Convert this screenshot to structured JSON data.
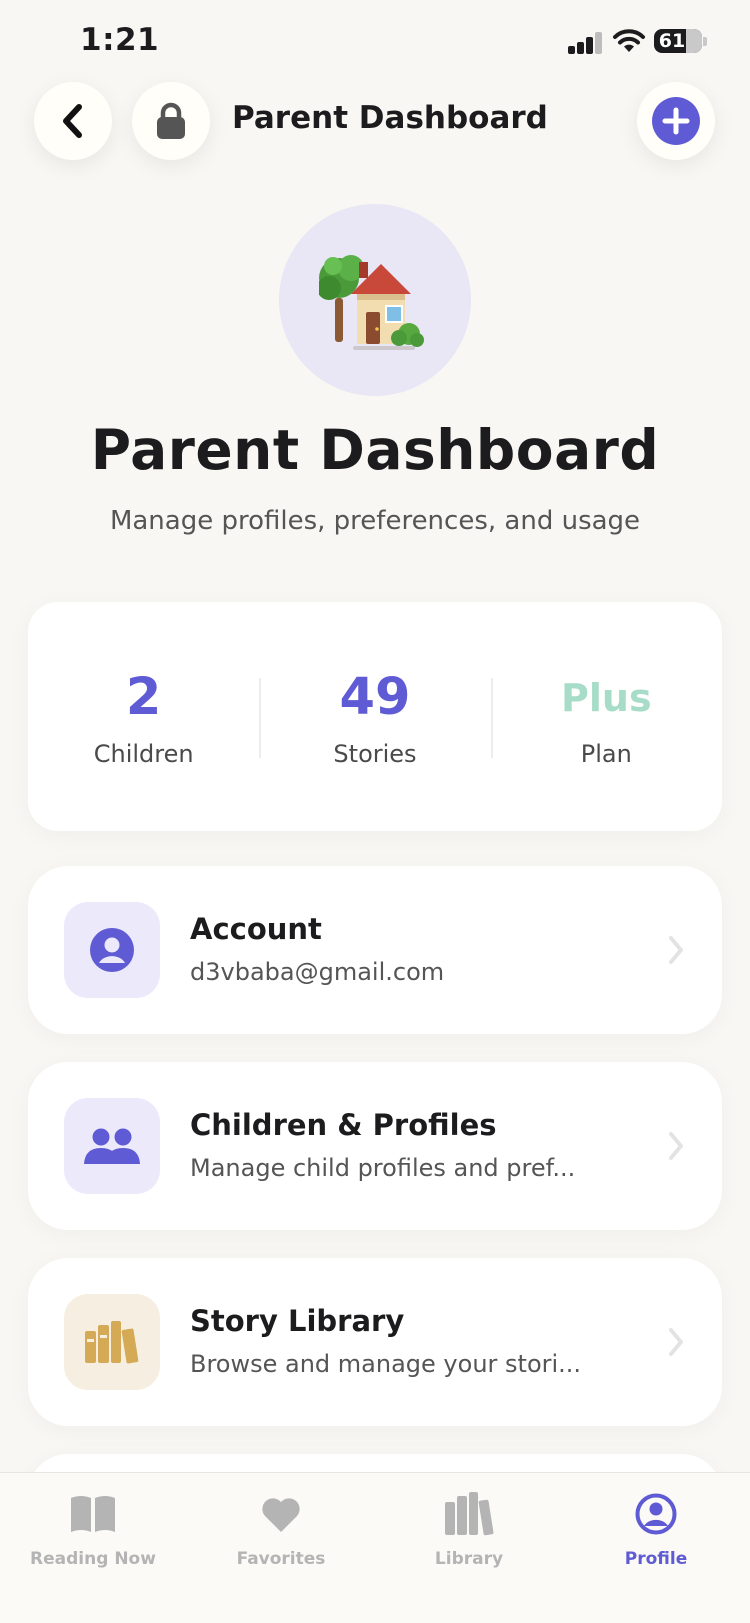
{
  "status_bar": {
    "time": "1:21",
    "battery": "61"
  },
  "nav": {
    "title": "Parent Dashboard"
  },
  "hero": {
    "emoji": "🏡",
    "title": "Parent Dashboard",
    "subtitle": "Manage profiles, preferences, and usage"
  },
  "stats": [
    {
      "value": "2",
      "label": "Children",
      "color": "#5f5bd4"
    },
    {
      "value": "49",
      "label": "Stories",
      "color": "#5f5bd4"
    },
    {
      "value": "Plus",
      "label": "Plan",
      "color": "#a7dcc8"
    }
  ],
  "menu": [
    {
      "title": "Account",
      "subtitle": "d3vbaba@gmail.com",
      "icon": "person-icon",
      "icon_bg": "#ece9fb"
    },
    {
      "title": "Children & Profiles",
      "subtitle": "Manage child profiles and pref...",
      "icon": "people-icon",
      "icon_bg": "#ece9fb"
    },
    {
      "title": "Story Library",
      "subtitle": "Browse and manage your stori...",
      "icon": "books-icon",
      "icon_bg": "#f6efe1"
    }
  ],
  "tabs": [
    {
      "label": "Reading Now",
      "icon": "book-icon",
      "active": false
    },
    {
      "label": "Favorites",
      "icon": "heart-icon",
      "active": false
    },
    {
      "label": "Library",
      "icon": "books-icon",
      "active": false
    },
    {
      "label": "Profile",
      "icon": "profile-icon",
      "active": true
    }
  ],
  "colors": {
    "accent": "#5f5bd4",
    "background": "#f8f7f3",
    "plan": "#a7dcc8",
    "library_icon": "#d4aa57"
  }
}
